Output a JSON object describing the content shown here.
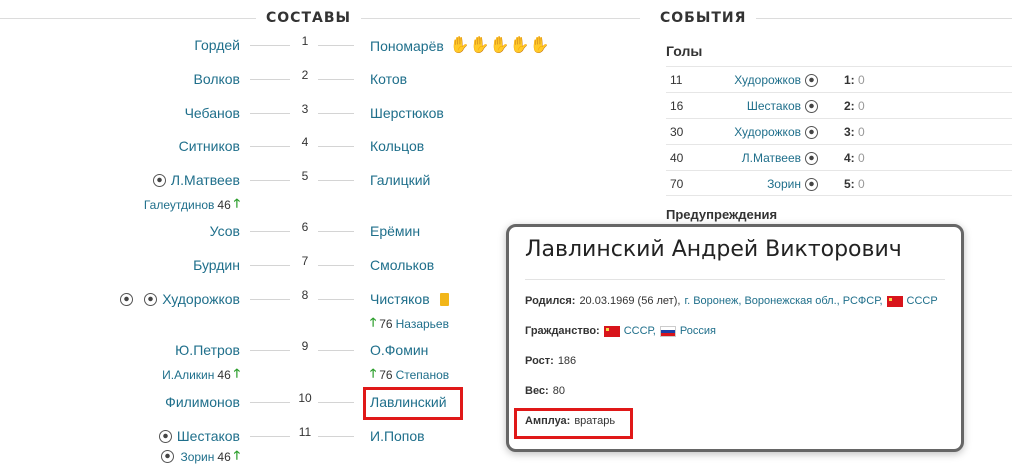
{
  "lineups": {
    "header": "СОСТАВЫ",
    "rows": [
      {
        "num": "1",
        "home": "Гордей",
        "away": "Пономарёв"
      },
      {
        "num": "2",
        "home": "Волков",
        "away": "Котов"
      },
      {
        "num": "3",
        "home": "Чебанов",
        "away": "Шерстюков"
      },
      {
        "num": "4",
        "home": "Ситников",
        "away": "Кольцов"
      },
      {
        "num": "5",
        "home": "Л.Матвеев",
        "away": "Галицкий",
        "home_sub": "Галеутдинов",
        "home_sub_min": "46"
      },
      {
        "num": "6",
        "home": "Усов",
        "away": "Ерёмин"
      },
      {
        "num": "7",
        "home": "Бурдин",
        "away": "Смольков"
      },
      {
        "num": "8",
        "home": "Худорожков",
        "away": "Чистяков",
        "away_sub": "Назарьев",
        "away_sub_min": "76"
      },
      {
        "num": "9",
        "home": "Ю.Петров",
        "away": "О.Фомин",
        "home_sub": "И.Аликин",
        "home_sub_min": "46",
        "away_sub": "Степанов",
        "away_sub_min": "76"
      },
      {
        "num": "10",
        "home": "Филимонов",
        "away": "Лавлинский"
      },
      {
        "num": "11",
        "home": "Шестаков",
        "away": "И.Попов",
        "home_sub": "Зорин",
        "home_sub_min": "46"
      }
    ],
    "conceded_icons": 5
  },
  "events": {
    "header": "СОБЫТИЯ",
    "goals_title": "Голы",
    "goals": [
      {
        "minute": "11",
        "player": "Худорожков",
        "score_home": "1:",
        "score_away": "0"
      },
      {
        "minute": "16",
        "player": "Шестаков",
        "score_home": "2:",
        "score_away": "0"
      },
      {
        "minute": "30",
        "player": "Худорожков",
        "score_home": "3:",
        "score_away": "0"
      },
      {
        "minute": "40",
        "player": "Л.Матвеев",
        "score_home": "4:",
        "score_away": "0"
      },
      {
        "minute": "70",
        "player": "Зорин",
        "score_home": "5:",
        "score_away": "0"
      }
    ],
    "warnings_title": "Предупреждения"
  },
  "popup": {
    "name": "Лавлинский Андрей Викторович",
    "born_label": "Родился:",
    "born_date": "20.03.1969 (56 лет),",
    "born_place": "г. Воронеж, Воронежская обл., РСФСР,",
    "born_country": "СССР",
    "citizenship_label": "Гражданство:",
    "citizenship_1": "СССР,",
    "citizenship_2": "Россия",
    "height_label": "Рост:",
    "height_value": "186",
    "weight_label": "Вес:",
    "weight_value": "80",
    "role_label": "Амплуа:",
    "role_value": "вратарь"
  },
  "colors": {
    "link": "#1f6f8b",
    "highlight": "#e01818",
    "sub_arrow": "#2a9d2a",
    "yellow_card": "#f2b619",
    "glove": "#cc1111"
  },
  "icons": {
    "goal": "soccer-ball-icon",
    "conceded": "goalkeeper-glove-icon",
    "sub_in": "arrow-up-icon",
    "booking": "yellow-card-icon"
  }
}
